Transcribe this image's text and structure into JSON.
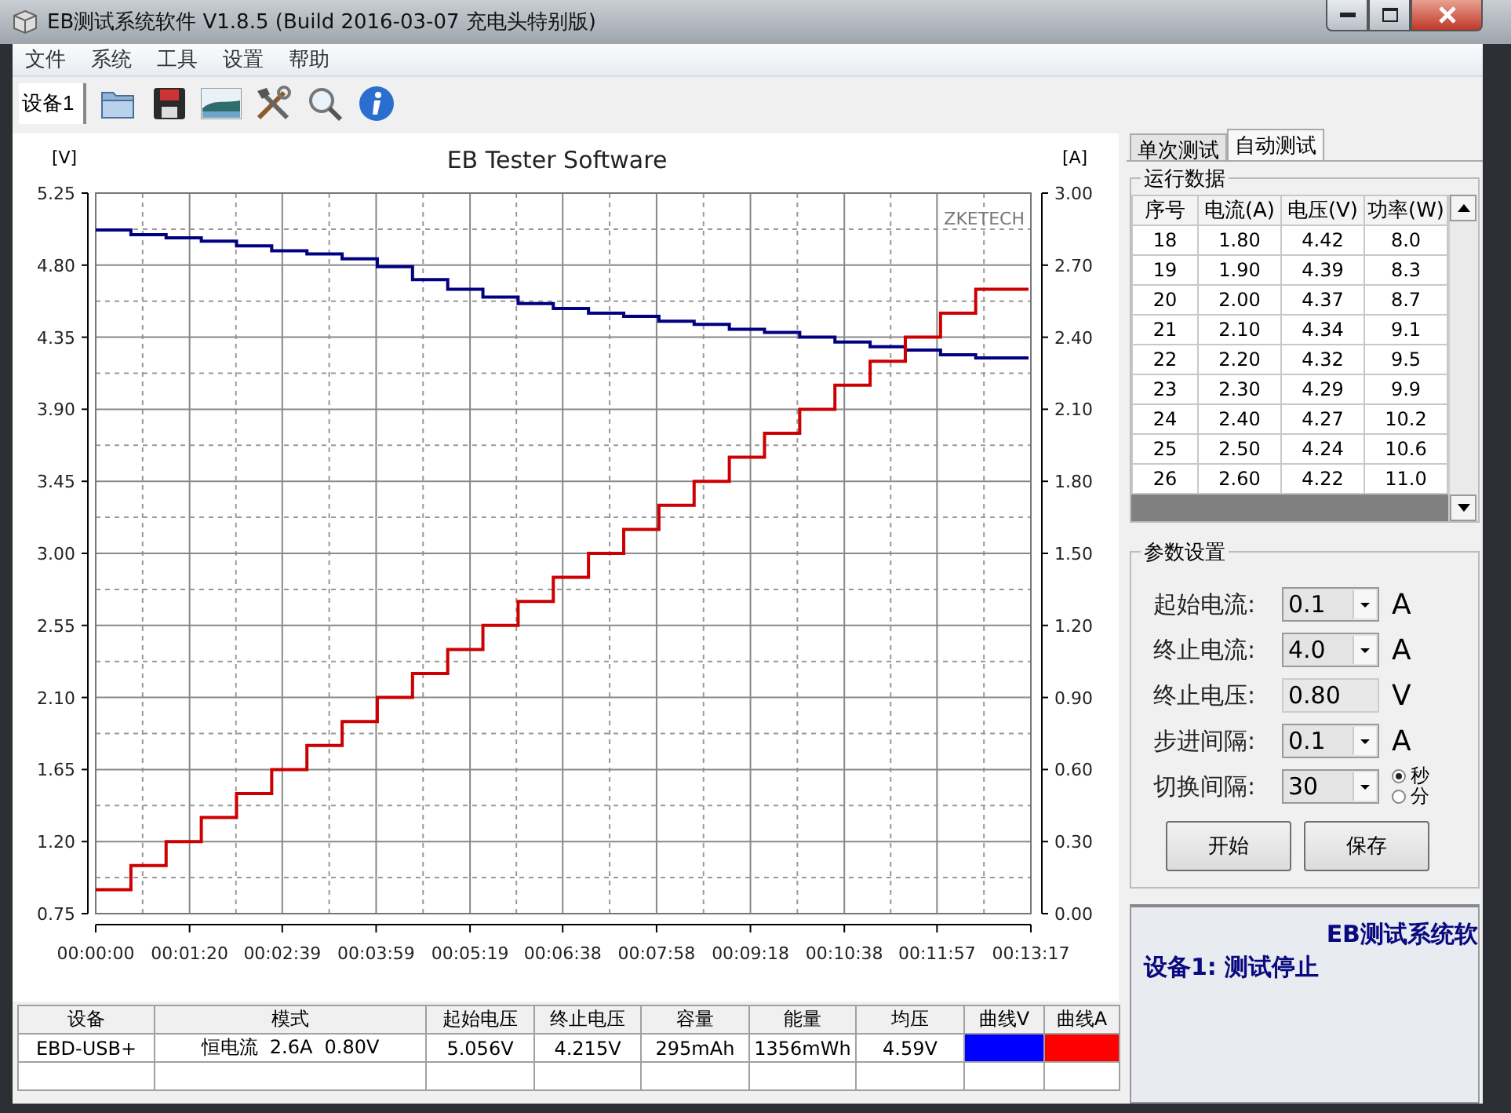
{
  "window": {
    "title": "EB测试系统软件 V1.8.5 (Build 2016-03-07 充电头特别版)"
  },
  "menu": [
    "文件",
    "系统",
    "工具",
    "设置",
    "帮助"
  ],
  "toolbar": {
    "device_tab": "设备1"
  },
  "chart": {
    "caption": "ZKETECH",
    "chart_data": {
      "type": "line",
      "title": "EB Tester Software",
      "ylabel": "[V]",
      "y2label": "[A]",
      "xlim": [
        0,
        797
      ],
      "ylim": [
        0.75,
        5.25
      ],
      "y2lim": [
        0,
        3
      ],
      "xticks": [
        {
          "value": 0,
          "label": "00:00:00"
        },
        {
          "value": 80,
          "label": "00:01:20"
        },
        {
          "value": 159,
          "label": "00:02:39"
        },
        {
          "value": 239,
          "label": "00:03:59"
        },
        {
          "value": 319,
          "label": "00:05:19"
        },
        {
          "value": 398,
          "label": "00:06:38"
        },
        {
          "value": 478,
          "label": "00:07:58"
        },
        {
          "value": 558,
          "label": "00:09:18"
        },
        {
          "value": 638,
          "label": "00:10:38"
        },
        {
          "value": 717,
          "label": "00:11:57"
        },
        {
          "value": 797,
          "label": "00:13:17"
        }
      ],
      "yticks": [
        {
          "value": 0.75,
          "label": "0.75"
        },
        {
          "value": 1.2,
          "label": "1.20"
        },
        {
          "value": 1.65,
          "label": "1.65"
        },
        {
          "value": 2.1,
          "label": "2.10"
        },
        {
          "value": 2.55,
          "label": "2.55"
        },
        {
          "value": 3,
          "label": "3.00"
        },
        {
          "value": 3.45,
          "label": "3.45"
        },
        {
          "value": 3.9,
          "label": "3.90"
        },
        {
          "value": 4.35,
          "label": "4.35"
        },
        {
          "value": 4.8,
          "label": "4.80"
        },
        {
          "value": 5.25,
          "label": "5.25"
        }
      ],
      "y2ticks": [
        {
          "value": 0,
          "label": "0.00"
        },
        {
          "value": 0.3,
          "label": "0.30"
        },
        {
          "value": 0.6,
          "label": "0.60"
        },
        {
          "value": 0.9,
          "label": "0.90"
        },
        {
          "value": 1.2,
          "label": "1.20"
        },
        {
          "value": 1.5,
          "label": "1.50"
        },
        {
          "value": 1.8,
          "label": "1.80"
        },
        {
          "value": 2.1,
          "label": "2.10"
        },
        {
          "value": 2.4,
          "label": "2.40"
        },
        {
          "value": 2.7,
          "label": "2.70"
        },
        {
          "value": 3,
          "label": "3.00"
        }
      ],
      "grid": true,
      "x": [
        0,
        30,
        30,
        60,
        60,
        90,
        90,
        120,
        120,
        150,
        150,
        180,
        180,
        210,
        210,
        240,
        240,
        270,
        270,
        300,
        300,
        330,
        330,
        360,
        360,
        390,
        390,
        420,
        420,
        450,
        450,
        480,
        480,
        510,
        510,
        540,
        540,
        570,
        570,
        600,
        600,
        630,
        630,
        660,
        660,
        690,
        690,
        720,
        720,
        750,
        750,
        795
      ],
      "series": [
        {
          "color": "#000080",
          "values": [
            5.02,
            5.02,
            4.99,
            4.99,
            4.97,
            4.97,
            4.95,
            4.95,
            4.92,
            4.92,
            4.89,
            4.89,
            4.87,
            4.87,
            4.84,
            4.84,
            4.79,
            4.79,
            4.71,
            4.71,
            4.65,
            4.65,
            4.6,
            4.6,
            4.56,
            4.56,
            4.53,
            4.53,
            4.5,
            4.5,
            4.48,
            4.48,
            4.45,
            4.45,
            4.43,
            4.43,
            4.4,
            4.4,
            4.38,
            4.38,
            4.35,
            4.35,
            4.32,
            4.32,
            4.29,
            4.29,
            4.27,
            4.27,
            4.24,
            4.24,
            4.22,
            4.22
          ]
        },
        {
          "color": "#cc0000",
          "axis": "y2",
          "values": [
            0.1,
            0.1,
            0.2,
            0.2,
            0.3,
            0.3,
            0.4,
            0.4,
            0.5,
            0.5,
            0.6,
            0.6,
            0.7,
            0.7,
            0.8,
            0.8,
            0.9,
            0.9,
            1.0,
            1.0,
            1.1,
            1.1,
            1.2,
            1.2,
            1.3,
            1.3,
            1.4,
            1.4,
            1.5,
            1.5,
            1.6,
            1.6,
            1.7,
            1.7,
            1.8,
            1.8,
            1.9,
            1.9,
            2.0,
            2.0,
            2.1,
            2.1,
            2.2,
            2.2,
            2.3,
            2.3,
            2.4,
            2.4,
            2.5,
            2.5,
            2.6,
            2.6
          ]
        }
      ]
    }
  },
  "summary": {
    "columns": [
      "设备",
      "模式",
      "起始电压",
      "终止电压",
      "容量",
      "能量",
      "均压",
      "曲线V",
      "曲线A"
    ],
    "rows": [
      {
        "cells": [
          "EBD-USB+",
          "恒电流  2.6A  0.80V",
          "5.056V",
          "4.215V",
          "295mAh",
          "1356mWh",
          "4.59V"
        ],
        "swatches": [
          {
            "color": "#0000ff"
          },
          {
            "color": "#ff0000"
          }
        ]
      }
    ]
  },
  "tabs": [
    {
      "label": "单次测试",
      "selected": false
    },
    {
      "label": "自动测试",
      "selected": true
    }
  ],
  "run_data": {
    "title": "运行数据",
    "columns": [
      "序号",
      "电流(A)",
      "电压(V)",
      "功率(W)"
    ],
    "rows": [
      [
        "18",
        "1.80",
        "4.42",
        "8.0"
      ],
      [
        "19",
        "1.90",
        "4.39",
        "8.3"
      ],
      [
        "20",
        "2.00",
        "4.37",
        "8.7"
      ],
      [
        "21",
        "2.10",
        "4.34",
        "9.1"
      ],
      [
        "22",
        "2.20",
        "4.32",
        "9.5"
      ],
      [
        "23",
        "2.30",
        "4.29",
        "9.9"
      ],
      [
        "24",
        "2.40",
        "4.27",
        "10.2"
      ],
      [
        "25",
        "2.50",
        "4.24",
        "10.6"
      ],
      [
        "26",
        "2.60",
        "4.22",
        "11.0"
      ]
    ]
  },
  "params": {
    "title": "参数设置",
    "fields": [
      {
        "label": "起始电流:",
        "kind": "combo",
        "value": "0.1",
        "unit": "A"
      },
      {
        "label": "终止电流:",
        "kind": "combo",
        "value": "4.0",
        "unit": "A"
      },
      {
        "label": "终止电压:",
        "kind": "text",
        "value": "0.80",
        "unit": "V"
      },
      {
        "label": "步进间隔:",
        "kind": "combo",
        "value": "0.1",
        "unit": "A"
      },
      {
        "label": "切换间隔:",
        "kind": "combo",
        "value": "30",
        "units": [
          {
            "label": "秒",
            "selected": true
          },
          {
            "label": "分",
            "selected": false
          }
        ]
      }
    ],
    "buttons": [
      "开始",
      "保存"
    ]
  },
  "status": {
    "heading": "EB测试系统软",
    "message": "设备1: 测试停止"
  }
}
